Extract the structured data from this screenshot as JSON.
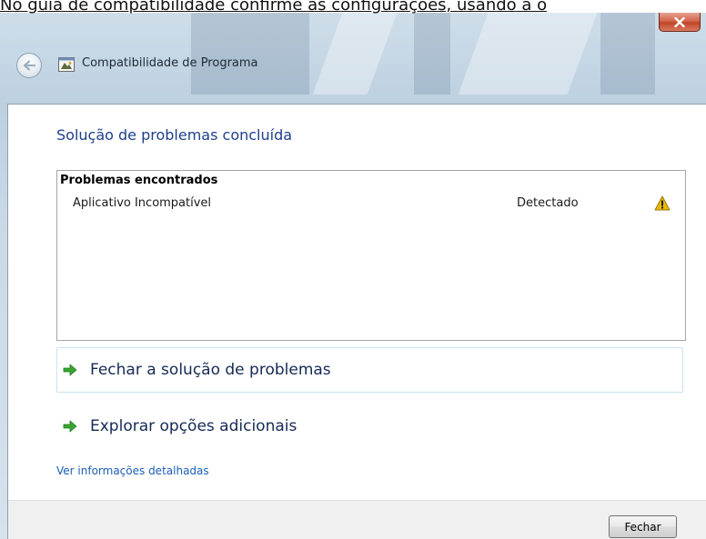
{
  "caption": "No guia de compatibilidade confirme as configurações, usando a o",
  "window": {
    "title": "Compatibilidade de Programa",
    "close_glyph": "x"
  },
  "main": {
    "heading": "Solução de problemas concluída",
    "problems_header": "Problemas encontrados",
    "problems": [
      {
        "name": "Aplicativo Incompatível",
        "status": "Detectado",
        "icon": "warning-icon"
      }
    ],
    "links": [
      {
        "label": "Fechar a solução de problemas",
        "icon": "green-arrow-icon"
      },
      {
        "label": "Explorar opções adicionais",
        "icon": "green-arrow-icon"
      }
    ],
    "details_link": "Ver informações detalhadas"
  },
  "footer": {
    "close_label": "Fechar"
  },
  "colors": {
    "heading": "#1e3f8c",
    "link": "#1a5fb4",
    "accent_arrow": "#3aa535",
    "warning": "#e8b90c"
  }
}
